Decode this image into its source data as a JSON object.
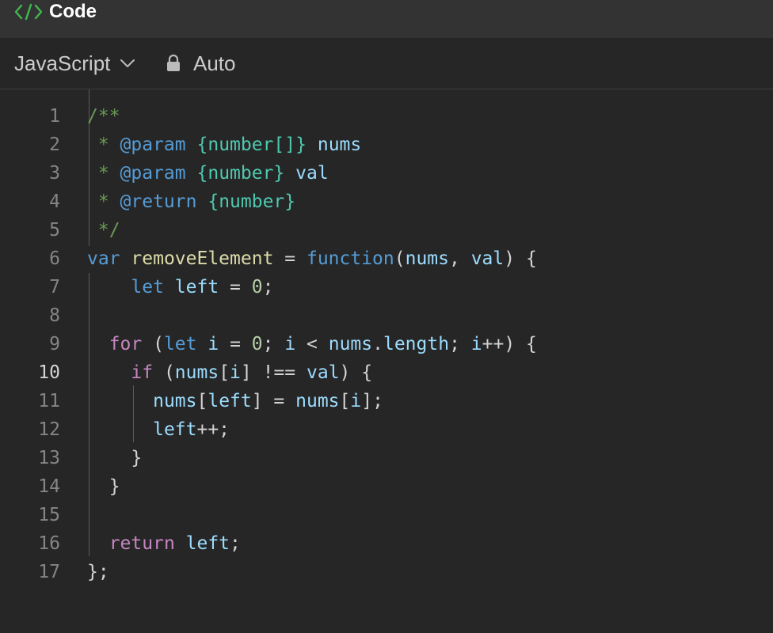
{
  "window": {
    "title": "Code",
    "title_icon": "code-brackets-icon"
  },
  "toolbar": {
    "language": "JavaScript",
    "language_icon": "chevron-down-icon",
    "mode": "Auto",
    "mode_icon": "lock-icon"
  },
  "editor": {
    "active_line": 10,
    "lines": [
      {
        "n": "1",
        "tokens": [
          [
            "c-comment",
            "/**"
          ]
        ]
      },
      {
        "n": "2",
        "tokens": [
          [
            "c-comment",
            " * "
          ],
          [
            "c-tag",
            "@param"
          ],
          [
            "c-comment",
            " "
          ],
          [
            "c-type",
            "{number[]}"
          ],
          [
            "c-comment",
            " "
          ],
          [
            "c-param",
            "nums"
          ]
        ]
      },
      {
        "n": "3",
        "tokens": [
          [
            "c-comment",
            " * "
          ],
          [
            "c-tag",
            "@param"
          ],
          [
            "c-comment",
            " "
          ],
          [
            "c-type",
            "{number}"
          ],
          [
            "c-comment",
            " "
          ],
          [
            "c-param",
            "val"
          ]
        ]
      },
      {
        "n": "4",
        "tokens": [
          [
            "c-comment",
            " * "
          ],
          [
            "c-tag",
            "@return"
          ],
          [
            "c-comment",
            " "
          ],
          [
            "c-type",
            "{number}"
          ]
        ]
      },
      {
        "n": "5",
        "tokens": [
          [
            "c-comment",
            " */"
          ]
        ]
      },
      {
        "n": "6",
        "tokens": [
          [
            "c-kw",
            "var"
          ],
          [
            "c-op",
            " "
          ],
          [
            "c-fn",
            "removeElement"
          ],
          [
            "c-op",
            " = "
          ],
          [
            "c-kw",
            "function"
          ],
          [
            "c-op",
            "("
          ],
          [
            "c-var",
            "nums"
          ],
          [
            "c-op",
            ", "
          ],
          [
            "c-var",
            "val"
          ],
          [
            "c-op",
            ") {"
          ]
        ]
      },
      {
        "n": "7",
        "tokens": [
          [
            "c-op",
            "    "
          ],
          [
            "c-kw",
            "let"
          ],
          [
            "c-op",
            " "
          ],
          [
            "c-var",
            "left"
          ],
          [
            "c-op",
            " = "
          ],
          [
            "c-num",
            "0"
          ],
          [
            "c-op",
            ";"
          ]
        ]
      },
      {
        "n": "8",
        "tokens": []
      },
      {
        "n": "9",
        "tokens": [
          [
            "c-op",
            "  "
          ],
          [
            "c-flow",
            "for"
          ],
          [
            "c-op",
            " ("
          ],
          [
            "c-kw",
            "let"
          ],
          [
            "c-op",
            " "
          ],
          [
            "c-var",
            "i"
          ],
          [
            "c-op",
            " = "
          ],
          [
            "c-num",
            "0"
          ],
          [
            "c-op",
            "; "
          ],
          [
            "c-var",
            "i"
          ],
          [
            "c-op",
            " < "
          ],
          [
            "c-var",
            "nums"
          ],
          [
            "c-op",
            "."
          ],
          [
            "c-var",
            "length"
          ],
          [
            "c-op",
            "; "
          ],
          [
            "c-var",
            "i"
          ],
          [
            "c-op",
            "++) {"
          ]
        ]
      },
      {
        "n": "10",
        "tokens": [
          [
            "c-op",
            "    "
          ],
          [
            "c-flow",
            "if"
          ],
          [
            "c-op",
            " ("
          ],
          [
            "c-var",
            "nums"
          ],
          [
            "c-op",
            "["
          ],
          [
            "c-var",
            "i"
          ],
          [
            "c-op",
            "] !== "
          ],
          [
            "c-var",
            "val"
          ],
          [
            "c-op",
            ") {"
          ]
        ]
      },
      {
        "n": "11",
        "tokens": [
          [
            "c-op",
            "      "
          ],
          [
            "c-var",
            "nums"
          ],
          [
            "c-op",
            "["
          ],
          [
            "c-var",
            "left"
          ],
          [
            "c-op",
            "] = "
          ],
          [
            "c-var",
            "nums"
          ],
          [
            "c-op",
            "["
          ],
          [
            "c-var",
            "i"
          ],
          [
            "c-op",
            "];"
          ]
        ]
      },
      {
        "n": "12",
        "tokens": [
          [
            "c-op",
            "      "
          ],
          [
            "c-var",
            "left"
          ],
          [
            "c-op",
            "++;"
          ]
        ]
      },
      {
        "n": "13",
        "tokens": [
          [
            "c-op",
            "    }"
          ]
        ]
      },
      {
        "n": "14",
        "tokens": [
          [
            "c-op",
            "  }"
          ]
        ]
      },
      {
        "n": "15",
        "tokens": []
      },
      {
        "n": "16",
        "tokens": [
          [
            "c-op",
            "  "
          ],
          [
            "c-flow",
            "return"
          ],
          [
            "c-op",
            " "
          ],
          [
            "c-var",
            "left"
          ],
          [
            "c-op",
            ";"
          ]
        ]
      },
      {
        "n": "17",
        "tokens": [
          [
            "c-op",
            "};"
          ]
        ]
      }
    ]
  }
}
